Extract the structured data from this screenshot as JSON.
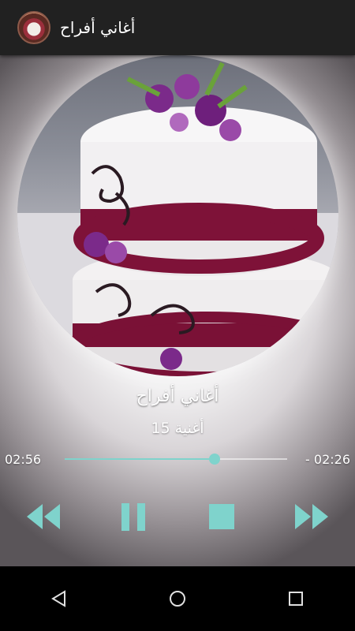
{
  "app": {
    "title": "أغاني أفراح"
  },
  "track": {
    "title": "أغاني أفراح",
    "subtitle": "أغنية 15",
    "elapsed": "02:56",
    "remaining": "- 02:26",
    "progress_fraction": 0.674
  },
  "colors": {
    "accent": "#7fd3cc",
    "appbar": "#212121"
  },
  "controls": {
    "rewind_icon": "rewind-icon",
    "pause_icon": "pause-icon",
    "stop_icon": "stop-icon",
    "fast_forward_icon": "fast-forward-icon"
  },
  "navigation": {
    "back_icon": "back-icon",
    "home_icon": "home-icon",
    "recents_icon": "recents-icon"
  }
}
